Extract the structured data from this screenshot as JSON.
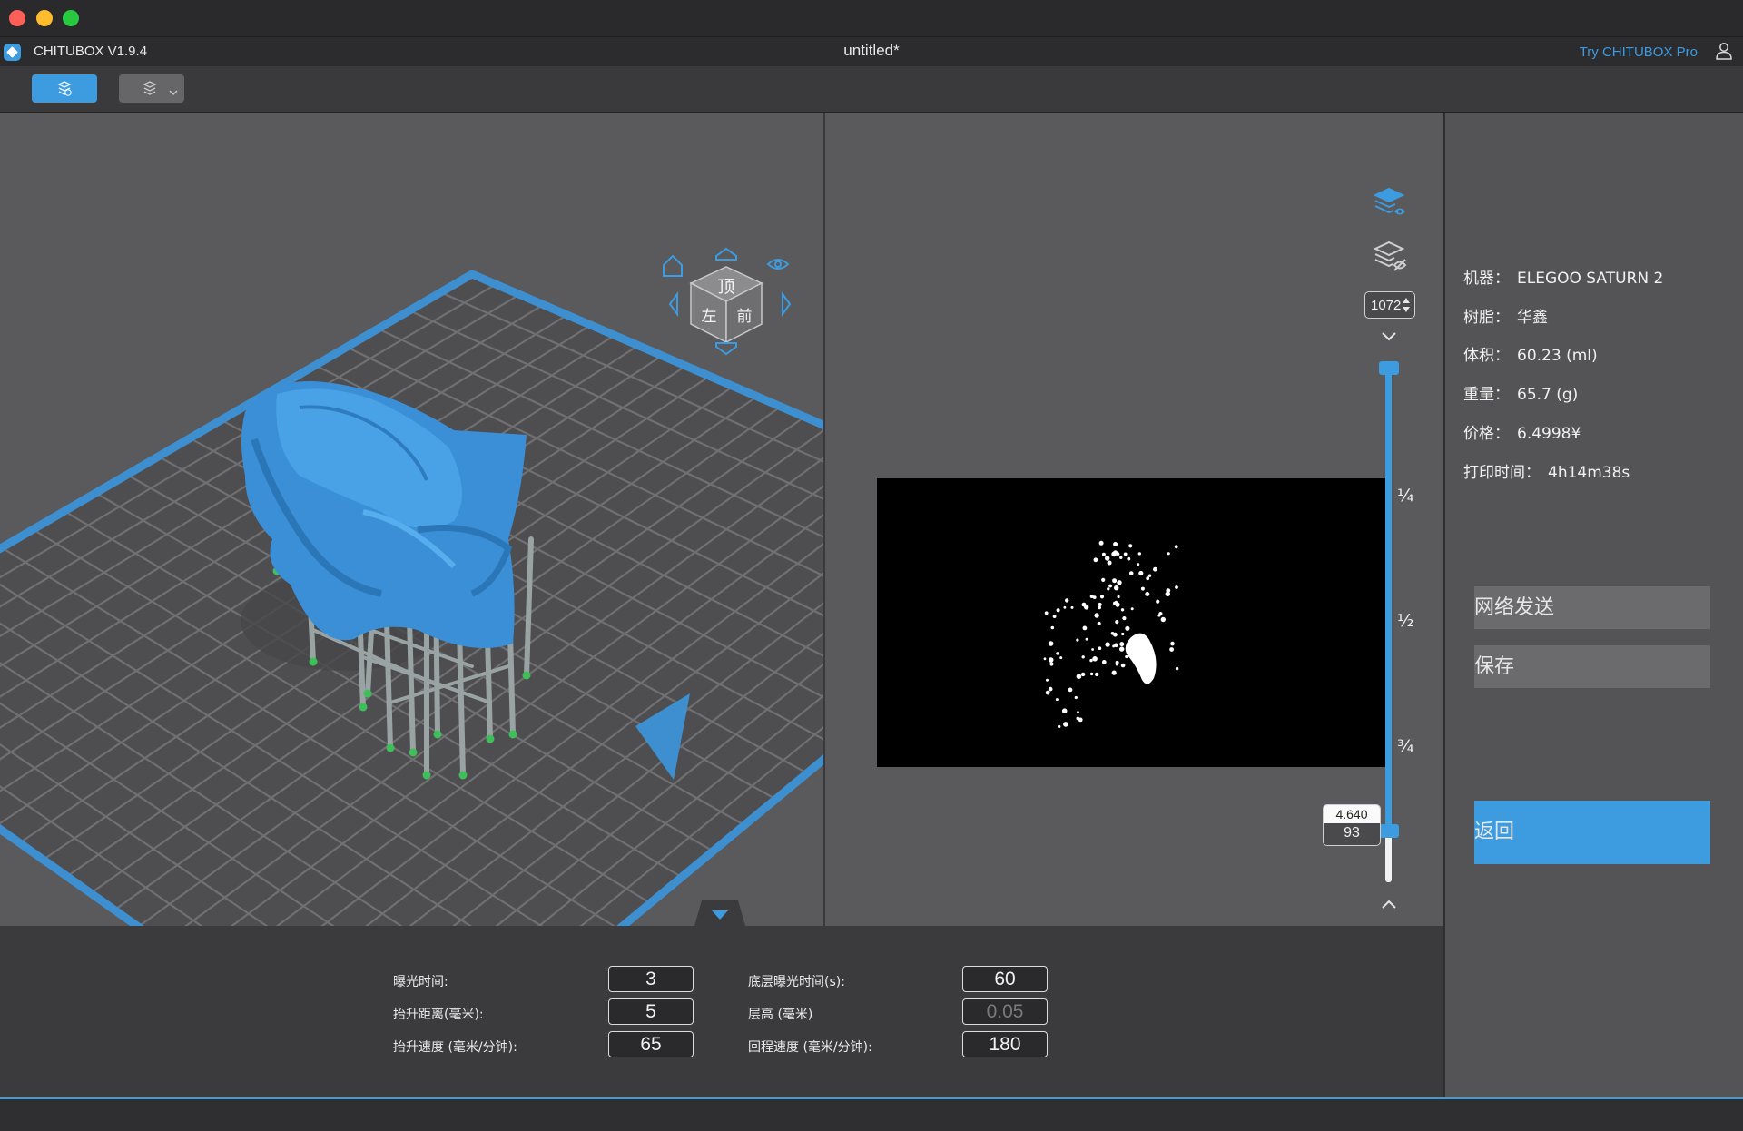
{
  "app": {
    "name": "CHITUBOX V1.9.4",
    "document_title": "untitled*",
    "try_pro": "Try CHITUBOX Pro"
  },
  "view_cube": {
    "top_face": "顶",
    "left_face": "左",
    "front_face": "前"
  },
  "layers": {
    "top_layer": "1072",
    "bottom_layer": "93",
    "bottom_height": "4.640",
    "marks": [
      "¼",
      "½",
      "¾"
    ]
  },
  "info": {
    "machine_label": "机器：",
    "machine_value": "ELEGOO SATURN 2",
    "resin_label": "树脂：",
    "resin_value": "华鑫",
    "volume_label": "体积：",
    "volume_value": "60.23 (ml)",
    "weight_label": "重量：",
    "weight_value": "65.7 (g)",
    "price_label": "价格：",
    "price_value": "6.4998¥",
    "time_label": "打印时间：",
    "time_value": "4h14m38s"
  },
  "buttons": {
    "send": "网络发送",
    "save": "保存",
    "back": "返回"
  },
  "params": {
    "exposure_label": "曝光时间:",
    "exposure_value": "3",
    "bottom_exposure_label": "底层曝光时间(s):",
    "bottom_exposure_value": "60",
    "lift_distance_label": "抬升距离(毫米):",
    "lift_distance_value": "5",
    "layer_height_label": "层高 (毫米)",
    "layer_height_value": "0.05",
    "lift_speed_label": "抬升速度 (毫米/分钟):",
    "lift_speed_value": "65",
    "retract_speed_label": "回程速度 (毫米/分钟):",
    "retract_speed_value": "180"
  },
  "colors": {
    "accent": "#3d9be0",
    "model": "#3a8fd6",
    "panel": "#5a5a5c",
    "close": "#ff5f57",
    "minimize": "#febc2e",
    "maximize": "#28c840"
  }
}
